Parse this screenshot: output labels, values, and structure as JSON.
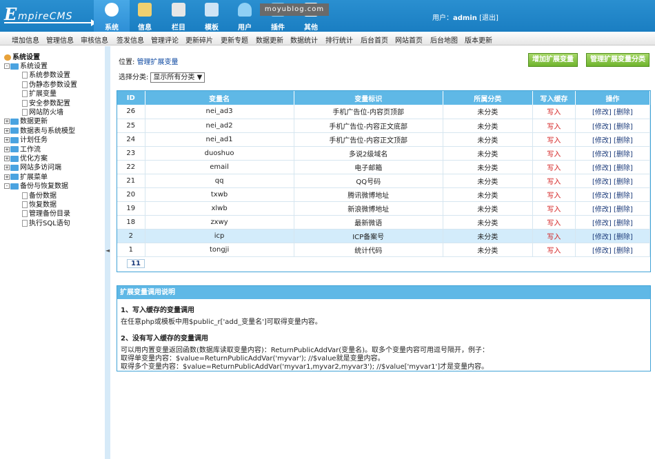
{
  "app": {
    "title_big": "E",
    "title_rest": "mpireCMS",
    "watermark": "moyublog.com"
  },
  "nav": [
    {
      "label": "系统",
      "icon": "globe-icon",
      "active": true
    },
    {
      "label": "信息",
      "icon": "document-icon"
    },
    {
      "label": "栏目",
      "icon": "folder-icon"
    },
    {
      "label": "模板",
      "icon": "window-icon"
    },
    {
      "label": "用户",
      "icon": "user-icon"
    },
    {
      "label": "插件",
      "icon": "puzzle-icon"
    },
    {
      "label": "其他",
      "icon": "other-icon"
    }
  ],
  "user": {
    "prefix": "用户：",
    "name": "admin",
    "logout": "[退出]"
  },
  "menu": [
    "增加信息",
    "管理信息",
    "审核信息",
    "签发信息",
    "管理评论",
    "更新碎片",
    "更新专题",
    "数据更新",
    "数据统计",
    "排行统计",
    "后台首页",
    "网站首页",
    "后台地图",
    "版本更新"
  ],
  "sidebar": {
    "root": "系统设置",
    "nodes": [
      {
        "label": "系统设置",
        "type": "folder",
        "exp": "-"
      },
      {
        "label": "系统参数设置",
        "type": "doc"
      },
      {
        "label": "伪静态参数设置",
        "type": "doc"
      },
      {
        "label": "扩展变量",
        "type": "doc"
      },
      {
        "label": "安全参数配置",
        "type": "doc"
      },
      {
        "label": "网站防火墙",
        "type": "doc"
      },
      {
        "label": "数据更新",
        "type": "folder",
        "exp": "+"
      },
      {
        "label": "数据表与系统模型",
        "type": "folder",
        "exp": "+"
      },
      {
        "label": "计划任务",
        "type": "folder",
        "exp": "+"
      },
      {
        "label": "工作流",
        "type": "folder",
        "exp": "+"
      },
      {
        "label": "优化方案",
        "type": "folder",
        "exp": "+"
      },
      {
        "label": "网站多访问端",
        "type": "folder",
        "exp": "+"
      },
      {
        "label": "扩展菜单",
        "type": "folder",
        "exp": "+"
      },
      {
        "label": "备份与恢复数据",
        "type": "folder",
        "exp": "-"
      },
      {
        "label": "备份数据",
        "type": "doc"
      },
      {
        "label": "恢复数据",
        "type": "doc"
      },
      {
        "label": "管理备份目录",
        "type": "doc"
      },
      {
        "label": "执行SQL语句",
        "type": "doc"
      }
    ]
  },
  "main": {
    "position_prefix": "位置: ",
    "position_link": "管理扩展变量",
    "btn_add": "增加扩展变量",
    "btn_manage": "管理扩展变量分类",
    "filter_label": "选择分类:",
    "filter_value": "显示所有分类",
    "columns": [
      "ID",
      "变量名",
      "变量标识",
      "所属分类",
      "写入缓存",
      "操作"
    ],
    "rows": [
      {
        "id": "26",
        "name": "nei_ad3",
        "tag": "手机广告位-内容页顶部",
        "cat": "未分类",
        "write": "写入",
        "ops": "[修改] [删除]"
      },
      {
        "id": "25",
        "name": "nei_ad2",
        "tag": "手机广告位-内容正文底部",
        "cat": "未分类",
        "write": "写入",
        "ops": "[修改] [删除]"
      },
      {
        "id": "24",
        "name": "nei_ad1",
        "tag": "手机广告位-内容正文顶部",
        "cat": "未分类",
        "write": "写入",
        "ops": "[修改] [删除]"
      },
      {
        "id": "23",
        "name": "duoshuo",
        "tag": "多说2级域名",
        "cat": "未分类",
        "write": "写入",
        "ops": "[修改] [删除]"
      },
      {
        "id": "22",
        "name": "email",
        "tag": "电子邮箱",
        "cat": "未分类",
        "write": "写入",
        "ops": "[修改] [删除]"
      },
      {
        "id": "21",
        "name": "qq",
        "tag": "QQ号码",
        "cat": "未分类",
        "write": "写入",
        "ops": "[修改] [删除]"
      },
      {
        "id": "20",
        "name": "txwb",
        "tag": "腾讯微博地址",
        "cat": "未分类",
        "write": "写入",
        "ops": "[修改] [删除]"
      },
      {
        "id": "19",
        "name": "xlwb",
        "tag": "新浪微博地址",
        "cat": "未分类",
        "write": "写入",
        "ops": "[修改] [删除]"
      },
      {
        "id": "18",
        "name": "zxwy",
        "tag": "最新微语",
        "cat": "未分类",
        "write": "写入",
        "ops": "[修改] [删除]"
      },
      {
        "id": "2",
        "name": "icp",
        "tag": "ICP备案号",
        "cat": "未分类",
        "write": "写入",
        "ops": "[修改] [删除]",
        "highlight": true
      },
      {
        "id": "1",
        "name": "tongji",
        "tag": "统计代码",
        "cat": "未分类",
        "write": "写入",
        "ops": "[修改] [删除]"
      }
    ],
    "pager": "11"
  },
  "help": {
    "title": "扩展变量调用说明",
    "h1": "1、写入缓存的变量调用",
    "p1": "在任意php或模板中用$public_r['add_变量名']可取得变量内容。",
    "h2": "2、没有写入缓存的变量调用",
    "p2a": "可以用内置变量返回函数(数据库读取变量内容)：ReturnPublicAddVar(变量名)。取多个变量内容可用逗号隔开，例子：",
    "p2b": "取得单变量内容：$value=ReturnPublicAddVar('myvar'); //$value就是变量内容。",
    "p2c": "取得多个变量内容：$value=ReturnPublicAddVar('myvar1,myvar2,myvar3'); //$value['myvar1']才是变量内容。"
  }
}
